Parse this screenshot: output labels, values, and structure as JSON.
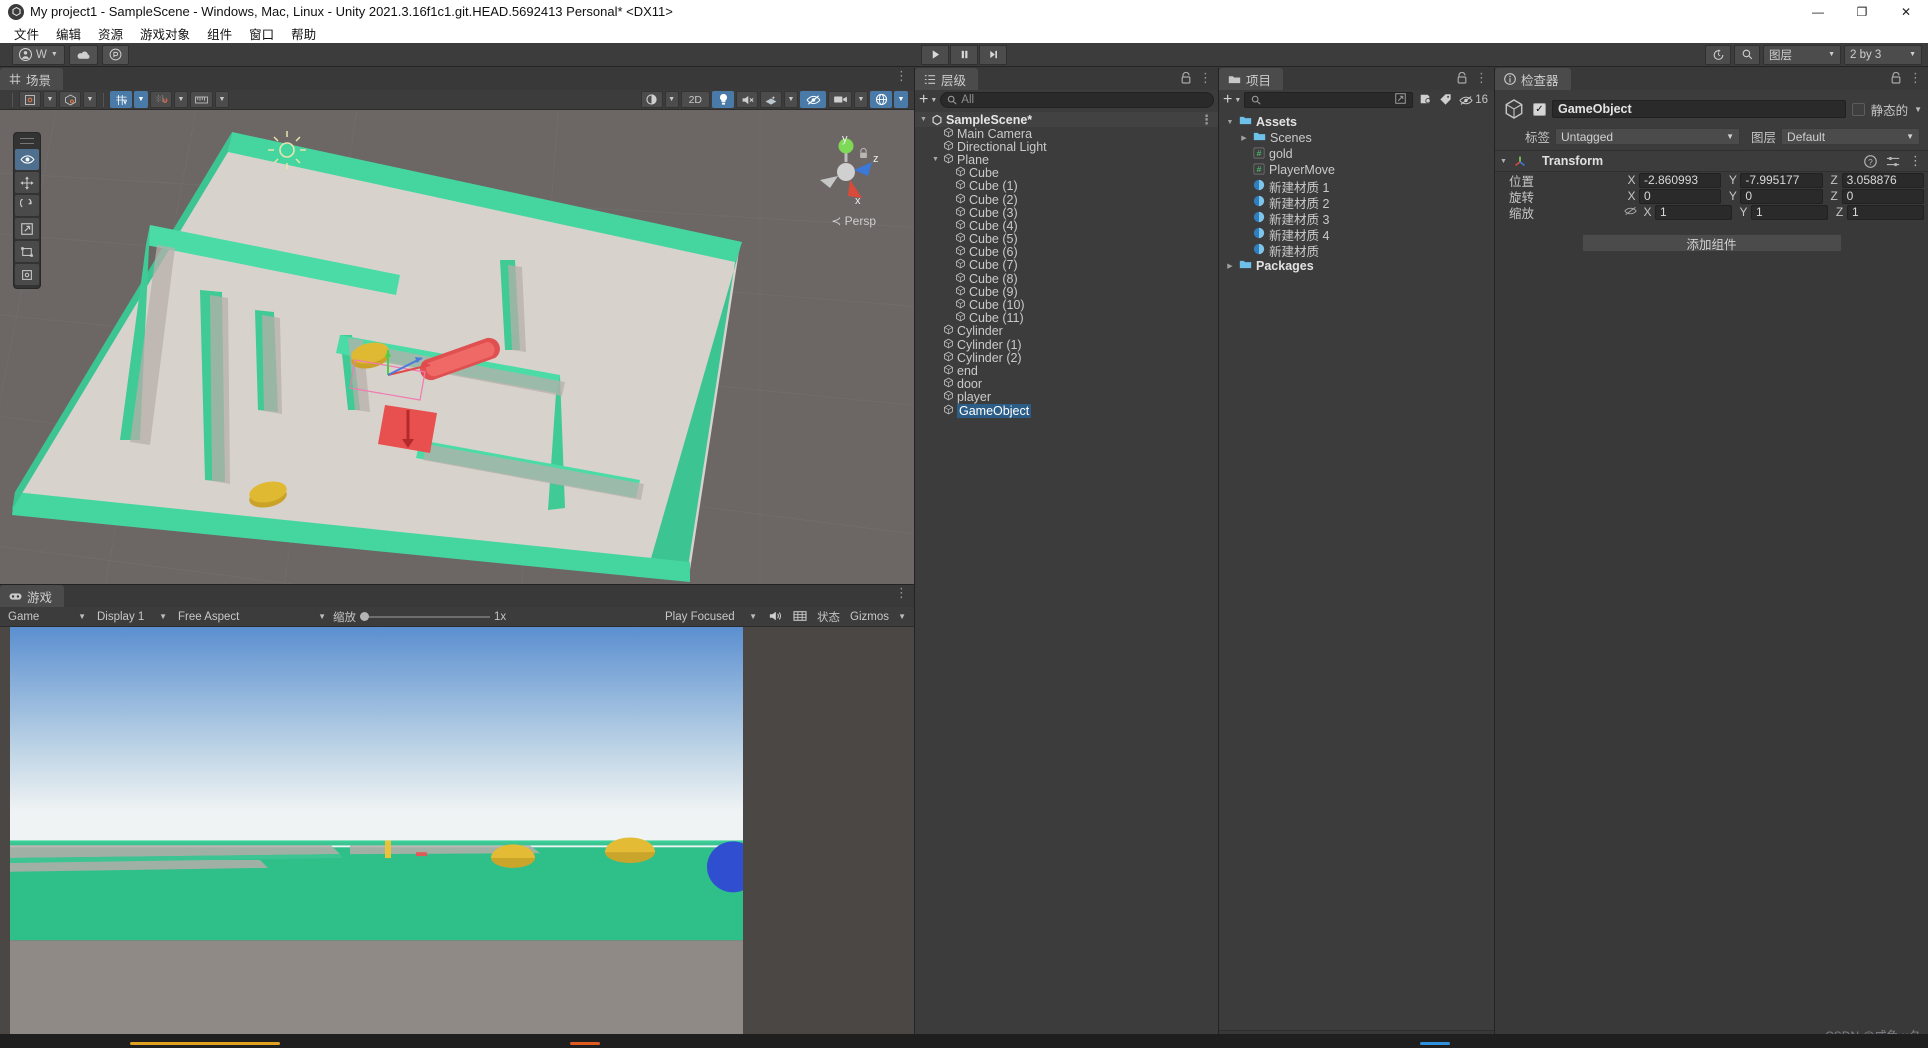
{
  "window": {
    "title": "My project1 - SampleScene - Windows, Mac, Linux - Unity 2021.3.16f1c1.git.HEAD.5692413 Personal* <DX11>",
    "logo_icon": "unity-logo",
    "minimize": "—",
    "maximize": "❐",
    "close": "✕"
  },
  "menubar": {
    "items": [
      "文件",
      "编辑",
      "资源",
      "游戏对象",
      "组件",
      "窗口",
      "帮助"
    ]
  },
  "main_toolbar": {
    "account_label": "W",
    "account_icon": "account-icon",
    "cloud_icon": "cloud-icon",
    "services_icon": "services-icon",
    "play": "▶",
    "pause": "⏸",
    "step": "⏭",
    "history_icon": "history-icon",
    "search_icon": "search-icon",
    "layers_label": "图层",
    "layout_label": "2 by 3"
  },
  "scene_panel": {
    "tab_label": "场景",
    "tab_icon": "scene-grid-icon",
    "kebab": "⋮",
    "tools": [
      {
        "name": "pivot-mode",
        "icon": "pivot-icon",
        "active": false
      },
      {
        "name": "pivot-rotation",
        "icon": "global-icon",
        "active": false
      },
      {
        "name": "grid-snap",
        "icon": "grid-snap-icon",
        "active": true
      },
      {
        "name": "magnet-snap",
        "icon": "magnet-icon",
        "active": false
      },
      {
        "name": "ruler-snap",
        "icon": "ruler-icon",
        "active": false
      }
    ],
    "right_tools": [
      {
        "name": "shading-mode",
        "icon": "sphere-icon",
        "active": false
      },
      {
        "name": "2d-toggle",
        "label": "2D",
        "active": false
      },
      {
        "name": "lighting-toggle",
        "icon": "bulb-icon",
        "active": true
      },
      {
        "name": "audio-toggle",
        "icon": "mute-icon",
        "active": false
      },
      {
        "name": "fx-toggle",
        "icon": "fx-icon",
        "active": false
      },
      {
        "name": "hidden-objects",
        "icon": "eye-off-icon",
        "active": true
      },
      {
        "name": "camera-settings",
        "icon": "camera-icon",
        "active": false
      },
      {
        "name": "gizmos-toggle",
        "icon": "gizmo-icon",
        "active": true
      }
    ],
    "left_tools": [
      {
        "name": "view-tool",
        "icon": "eye-icon",
        "active": true
      },
      {
        "name": "move-tool",
        "icon": "move-icon",
        "active": false
      },
      {
        "name": "rotate-tool",
        "icon": "rotate-icon",
        "active": false
      },
      {
        "name": "scale-tool",
        "icon": "scale-icon",
        "active": false
      },
      {
        "name": "rect-tool",
        "icon": "rect-icon",
        "active": false
      },
      {
        "name": "transform-tool",
        "icon": "transform-icon",
        "active": false
      }
    ],
    "gizmo": {
      "x": "x",
      "y": "y",
      "z": "z",
      "persp_label": "≺ Persp"
    }
  },
  "game_panel": {
    "tab_label": "游戏",
    "tab_icon": "game-icon",
    "kebab": "⋮",
    "mode": "Game",
    "display": "Display 1",
    "aspect": "Free Aspect",
    "zoom_label": "缩放",
    "zoom_value": "1x",
    "focus": "Play Focused",
    "mute_icon": "audio-icon",
    "stats_icon": "stats-icon",
    "stats_label": "状态",
    "gizmos_label": "Gizmos"
  },
  "hierarchy": {
    "tab_label": "层级",
    "tab_icon": "hierarchy-icon",
    "lock_icon": "lock-icon",
    "kebab": "⋮",
    "add_label": "+",
    "search_placeholder": "All",
    "scene_name": "SampleScene*",
    "items": [
      {
        "label": "Main Camera",
        "depth": 1,
        "expand": "",
        "selected": false
      },
      {
        "label": "Directional Light",
        "depth": 1,
        "expand": "",
        "selected": false
      },
      {
        "label": "Plane",
        "depth": 1,
        "expand": "▼",
        "selected": false
      },
      {
        "label": "Cube",
        "depth": 2,
        "expand": "",
        "selected": false
      },
      {
        "label": "Cube (1)",
        "depth": 2,
        "expand": "",
        "selected": false
      },
      {
        "label": "Cube (2)",
        "depth": 2,
        "expand": "",
        "selected": false
      },
      {
        "label": "Cube (3)",
        "depth": 2,
        "expand": "",
        "selected": false
      },
      {
        "label": "Cube (4)",
        "depth": 2,
        "expand": "",
        "selected": false
      },
      {
        "label": "Cube (5)",
        "depth": 2,
        "expand": "",
        "selected": false
      },
      {
        "label": "Cube (6)",
        "depth": 2,
        "expand": "",
        "selected": false
      },
      {
        "label": "Cube (7)",
        "depth": 2,
        "expand": "",
        "selected": false
      },
      {
        "label": "Cube (8)",
        "depth": 2,
        "expand": "",
        "selected": false
      },
      {
        "label": "Cube (9)",
        "depth": 2,
        "expand": "",
        "selected": false
      },
      {
        "label": "Cube (10)",
        "depth": 2,
        "expand": "",
        "selected": false
      },
      {
        "label": "Cube (11)",
        "depth": 2,
        "expand": "",
        "selected": false
      },
      {
        "label": "Cylinder",
        "depth": 1,
        "expand": "",
        "selected": false
      },
      {
        "label": "Cylinder (1)",
        "depth": 1,
        "expand": "",
        "selected": false
      },
      {
        "label": "Cylinder (2)",
        "depth": 1,
        "expand": "",
        "selected": false
      },
      {
        "label": "end",
        "depth": 1,
        "expand": "",
        "selected": false
      },
      {
        "label": "door",
        "depth": 1,
        "expand": "",
        "selected": false
      },
      {
        "label": "player",
        "depth": 1,
        "expand": "",
        "selected": false
      },
      {
        "label": "GameObject",
        "depth": 1,
        "expand": "",
        "selected": true
      }
    ]
  },
  "project": {
    "tab_label": "项目",
    "tab_icon": "folder-icon",
    "lock_icon": "lock-icon",
    "kebab": "⋮",
    "add_label": "+",
    "search_placeholder": "",
    "search_icon": "search-icon",
    "save_icon": "save-filter-icon",
    "label_icon": "tag-icon",
    "hidden_icon": "eye-off-icon",
    "hidden_count": "16",
    "tree": [
      {
        "label": "Assets",
        "depth": 0,
        "expand": "▼",
        "icon": "folder-open-icon",
        "bold": true
      },
      {
        "label": "Scenes",
        "depth": 1,
        "expand": "▶",
        "icon": "folder-icon",
        "bold": false
      },
      {
        "label": "gold",
        "depth": 1,
        "expand": "",
        "icon": "cs-script-icon",
        "bold": false
      },
      {
        "label": "PlayerMove",
        "depth": 1,
        "expand": "",
        "icon": "cs-script-icon",
        "bold": false
      },
      {
        "label": "新建材质 1",
        "depth": 1,
        "expand": "",
        "icon": "material-icon",
        "bold": false
      },
      {
        "label": "新建材质 2",
        "depth": 1,
        "expand": "",
        "icon": "material-icon",
        "bold": false
      },
      {
        "label": "新建材质 3",
        "depth": 1,
        "expand": "",
        "icon": "material-icon",
        "bold": false
      },
      {
        "label": "新建材质 4",
        "depth": 1,
        "expand": "",
        "icon": "material-icon",
        "bold": false
      },
      {
        "label": "新建材质",
        "depth": 1,
        "expand": "",
        "icon": "material-icon",
        "bold": false
      },
      {
        "label": "Packages",
        "depth": 0,
        "expand": "▶",
        "icon": "folder-icon",
        "bold": true
      }
    ]
  },
  "inspector": {
    "tab_label": "检查器",
    "tab_icon": "info-icon",
    "lock_icon": "lock-icon",
    "kebab": "⋮",
    "object_icon": "gameobject-icon",
    "enabled_check": "✓",
    "object_name": "GameObject",
    "static_label": "静态的",
    "tag_label": "标签",
    "tag_value": "Untagged",
    "layer_label": "图层",
    "layer_value": "Default",
    "transform": {
      "title": "Transform",
      "icon": "transform-axis-icon",
      "help_icon": "help-icon",
      "preset_icon": "preset-icon",
      "kebab": "⋮",
      "rows": [
        {
          "label": "位置",
          "x": "-2.860993",
          "y": "-7.995177",
          "z": "3.058876",
          "link": false
        },
        {
          "label": "旋转",
          "x": "0",
          "y": "0",
          "z": "0",
          "link": false
        },
        {
          "label": "缩放",
          "x": "1",
          "y": "1",
          "z": "1",
          "link": true
        }
      ],
      "axes": [
        "X",
        "Y",
        "Z"
      ]
    },
    "add_component_label": "添加组件"
  },
  "watermark": "CSDN @咸鱼 x夕"
}
